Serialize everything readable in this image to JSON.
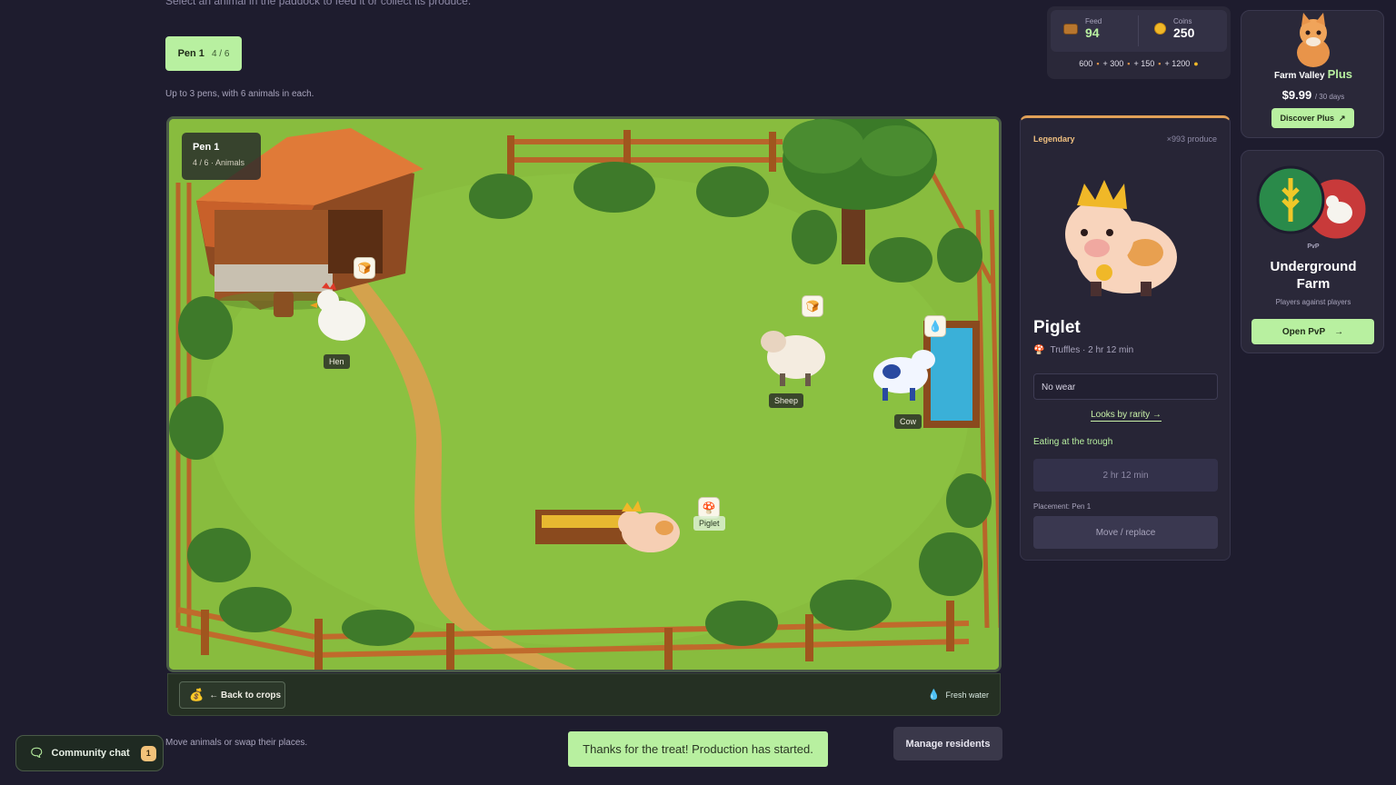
{
  "header": {
    "subtitle": "Select an animal in the paddock to feed it or collect its produce."
  },
  "pens": {
    "tab_label": "Pen 1",
    "tab_count": "4 / 6",
    "hint": "Up to 3 pens, with 6 animals in each."
  },
  "paddock": {
    "label_title": "Pen 1",
    "label_sub": "4 / 6 · Animals",
    "animals": [
      "Hen",
      "Sheep",
      "Cow",
      "Piglet"
    ],
    "back_button": "← Back to crops",
    "water_label": "Fresh water"
  },
  "footer": {
    "move_hint": "Move animals or swap their places.",
    "toast": "Thanks for the treat! Production has started.",
    "manage_button": "Manage residents",
    "community_label": "Community chat",
    "community_badge": "1"
  },
  "resources": {
    "feed_label": "Feed",
    "feed_value": "94",
    "coins_label": "Coins",
    "coins_value": "250",
    "packs": [
      {
        "amount": "600",
        "icon": "feed-icon"
      },
      {
        "amount": "+ 300",
        "icon": "feed-icon"
      },
      {
        "amount": "+ 150",
        "icon": "feed-icon"
      },
      {
        "amount": "+ 1200",
        "icon": "coin-icon"
      }
    ]
  },
  "detail": {
    "rarity": "Legendary",
    "produce_count": "×993 produce",
    "name": "Piglet",
    "production": "Truffles · 2 hr 12 min",
    "wear": "No wear",
    "looks_link": "Looks by rarity →",
    "status": "Eating at the trough",
    "timer": "2 hr 12 min",
    "placement": "Placement: Pen 1",
    "move_button": "Move / replace"
  },
  "plus": {
    "brand": "Farm Valley",
    "tier": "Plus",
    "price": "$9.99",
    "period": "/ 30 days",
    "button": "Discover Plus"
  },
  "pvp": {
    "tag": "PvP",
    "title": "Underground Farm",
    "subtitle": "Players against players",
    "button": "Open PvP"
  },
  "colors": {
    "background": "#1e1c2e",
    "accent": "#b8f0a0",
    "grass": "#84b83c",
    "legendary": "#e0a058"
  }
}
